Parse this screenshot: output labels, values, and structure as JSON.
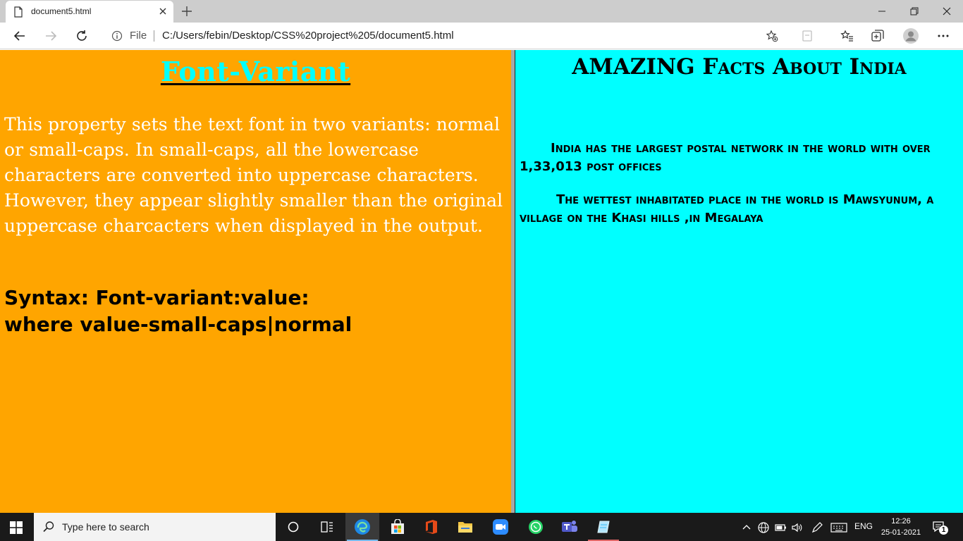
{
  "browser": {
    "tab_title": "document5.html",
    "address_prefix": "File",
    "url": "C:/Users/febin/Desktop/CSS%20project%205/document5.html"
  },
  "left_panel": {
    "heading": "Font-Variant",
    "paragraph": "This property sets the text font in two variants: normal or small-caps. In small-caps, all the lowercase characters are converted into uppercase characters. However, they appear slightly smaller than the original uppercase charcacters when displayed in the output.",
    "syntax_line1": "Syntax: Font-variant:value:",
    "syntax_line2": "where value-small-caps|normal",
    "background_color": "#ffa500",
    "heading_color": "#00ffff"
  },
  "right_panel": {
    "heading": "AMAZING Facts About India",
    "fact1": "India has the largest postal network in the world with over 1,33,013 post offices",
    "fact2": "The wettest inhabitated place in the world is Mawsyunum, a village on the Khasi hills ,in Megalaya",
    "background_color": "#00ffff"
  },
  "taskbar": {
    "search_placeholder": "Type here to search",
    "language": "ENG",
    "time": "12:26",
    "date": "25-01-2021",
    "notification_count": "1"
  }
}
